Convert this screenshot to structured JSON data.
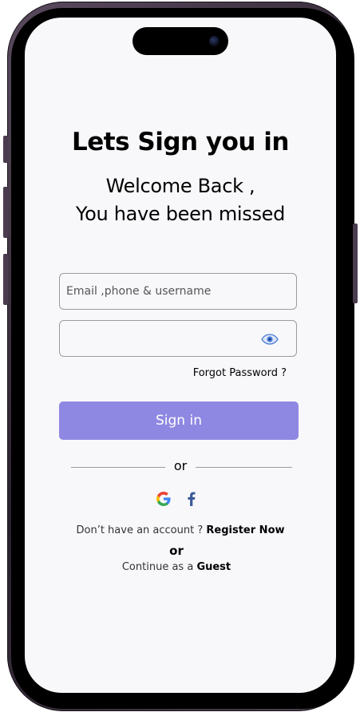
{
  "header": {
    "title": "Lets Sign you in",
    "subtitle_line1": "Welcome Back ,",
    "subtitle_line2": "You have been missed"
  },
  "form": {
    "email_placeholder": "Email ,phone & username",
    "email_value": "",
    "password_value": "",
    "forgot_password": "Forgot Password ?",
    "signin_label": "Sign in"
  },
  "divider": {
    "or_label": "or"
  },
  "social": {
    "icons": [
      "google-icon",
      "facebook-icon"
    ]
  },
  "footer": {
    "register_prompt": "Don’t have an account ?",
    "register_link": "Register Now",
    "or_label": "or",
    "guest_prompt": "Continue as a",
    "guest_link": "Guest"
  },
  "colors": {
    "accent": "#8f88e2",
    "background": "#f8f8fb",
    "frame": "#000000"
  }
}
